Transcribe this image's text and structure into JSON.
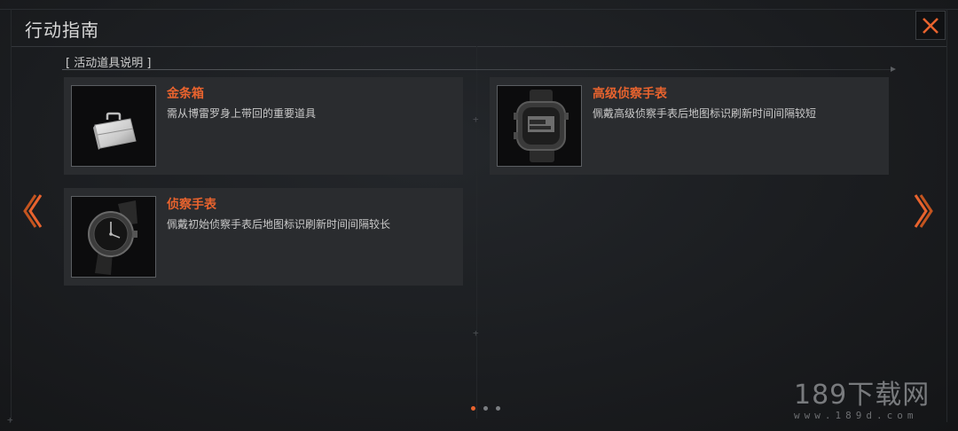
{
  "header": {
    "title": "行动指南",
    "close_icon": "close-x-icon",
    "accent_color": "#e8632e"
  },
  "section": {
    "heading": "[ 活动道具说明 ]"
  },
  "items": [
    {
      "name": "金条箱",
      "description": "需从博雷罗身上带回的重要道具",
      "icon": "silver-briefcase-icon"
    },
    {
      "name": "高级侦察手表",
      "description": "佩戴高级侦察手表后地图标识刷新时间间隔较短",
      "icon": "digital-watch-icon"
    },
    {
      "name": "侦察手表",
      "description": "佩戴初始侦察手表后地图标识刷新时间间隔较长",
      "icon": "analog-watch-icon"
    }
  ],
  "navigation": {
    "prev_icon": "chevron-left-icon",
    "next_icon": "chevron-right-icon"
  },
  "pagination": {
    "total_pages": 3,
    "current_page": 1
  },
  "watermark": {
    "main": "189下载网",
    "sub": "www.189d.com"
  }
}
